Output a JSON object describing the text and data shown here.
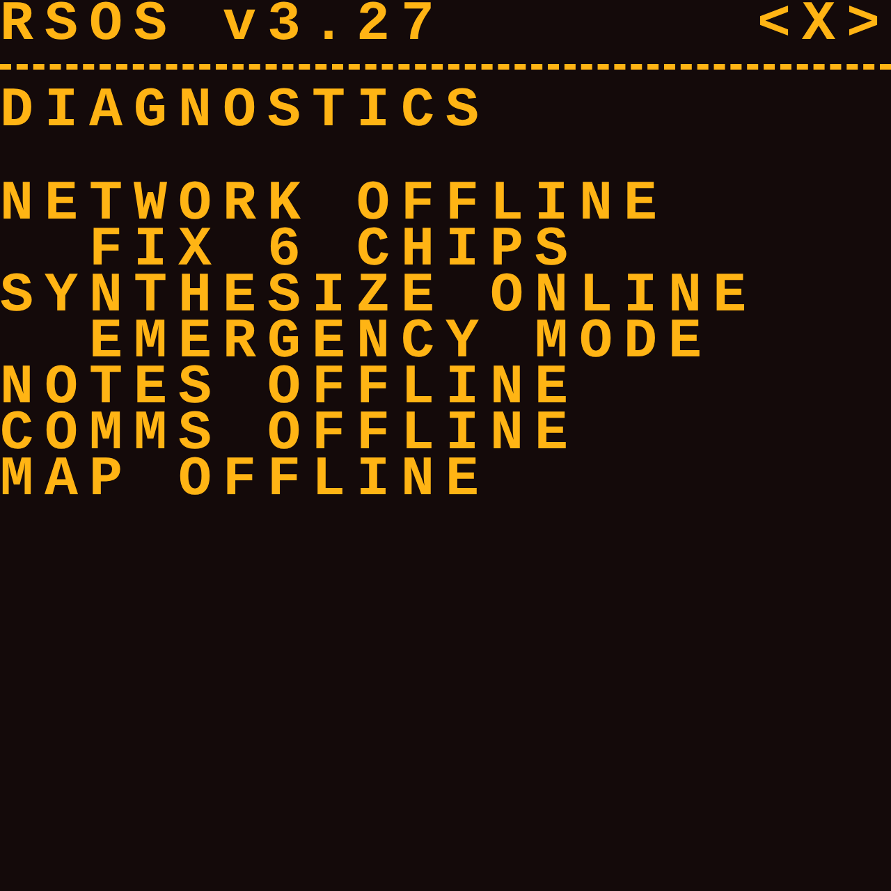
{
  "header": {
    "title": "RSOS v3.27",
    "close": "<X>"
  },
  "heading": "DIAGNOSTICS",
  "modules": [
    {
      "text": "NETWORK OFFLINE",
      "children": [
        {
          "text": "FIX 6 CHIPS"
        }
      ]
    },
    {
      "text": "SYNTHESIZE ONLINE",
      "children": [
        {
          "text": "EMERGENCY MODE"
        }
      ]
    },
    {
      "text": "NOTES OFFLINE"
    },
    {
      "text": "COMMS OFFLINE"
    },
    {
      "text": "MAP OFFLINE"
    }
  ]
}
